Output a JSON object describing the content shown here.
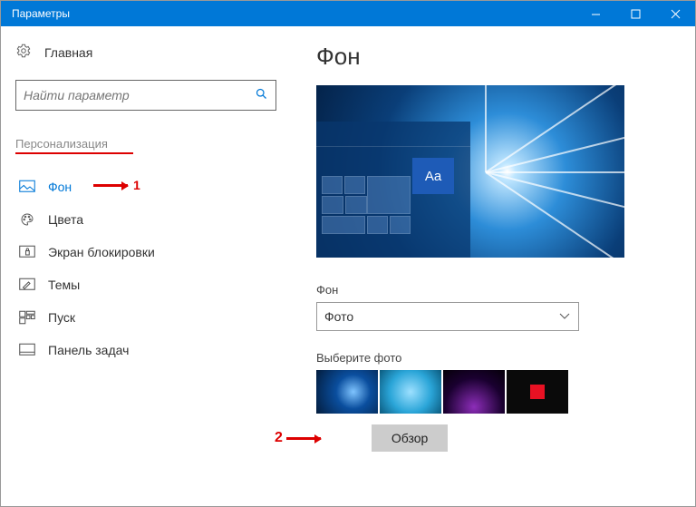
{
  "window": {
    "title": "Параметры"
  },
  "sidebar": {
    "home": "Главная",
    "search_placeholder": "Найти параметр",
    "section": "Персонализация",
    "items": [
      {
        "label": "Фон"
      },
      {
        "label": "Цвета"
      },
      {
        "label": "Экран блокировки"
      },
      {
        "label": "Темы"
      },
      {
        "label": "Пуск"
      },
      {
        "label": "Панель задач"
      }
    ]
  },
  "main": {
    "heading": "Фон",
    "preview_sample_text": "Aa",
    "bg_label": "Фон",
    "bg_value": "Фото",
    "choose_label": "Выберите фото",
    "browse": "Обзор"
  },
  "annotations": {
    "one": "1",
    "two": "2"
  }
}
